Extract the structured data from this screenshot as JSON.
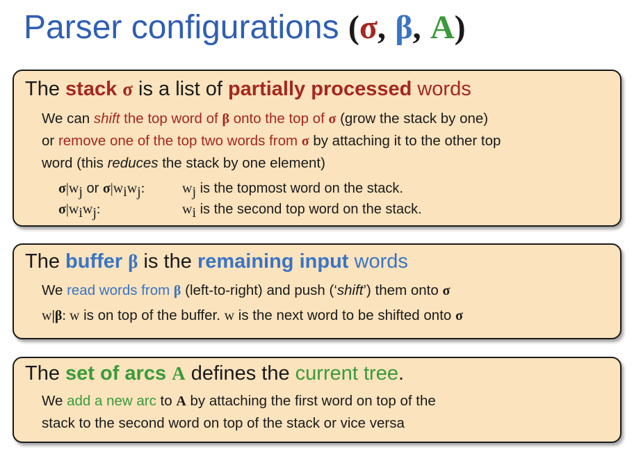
{
  "title": {
    "text": "Parser configurations",
    "open_paren": "(",
    "sigma": "σ",
    "comma1": ",",
    "beta": "β",
    "comma2": ",",
    "arcs": "A",
    "close_paren": ")"
  },
  "stack_box": {
    "heading": {
      "p1": "The ",
      "stack": "stack",
      "sigma": "σ",
      "p2": " is a list of ",
      "partially_processed": "partially processed",
      "words": " words"
    },
    "body": {
      "we_can": "We can ",
      "shift": "shift",
      "the_top_word_of": " the top word of ",
      "beta": "β",
      "onto_top_of": " onto the top of ",
      "sigma": "σ",
      "grow": " (grow the stack by one)",
      "or": "or ",
      "remove": "remove one of the top two words from ",
      "sigma2": "σ",
      "attaching": " by attaching it to the other top",
      "word_this": "word (this ",
      "reduces": "reduces",
      "by_one": " the stack by one element)"
    },
    "notation": [
      {
        "sigma": "σ",
        "bar_wj": "|w",
        "j": "j",
        "or": " or ",
        "sigma2": "σ",
        "bar_wi": "|w",
        "i": "i",
        "w": "w",
        "j2": "j",
        "colon": ":",
        "desc_w": "w",
        "desc_j": "j",
        "desc": " is the topmost word on the stack."
      },
      {
        "sigma": "σ",
        "bar_wi": "|w",
        "i": "i",
        "w": "w",
        "j": "j",
        "colon": ":",
        "desc_w": "w",
        "desc_i": "i",
        "desc": " is the second top word on the stack."
      }
    ]
  },
  "buffer_box": {
    "heading": {
      "p1": "The ",
      "buffer": "buffer",
      "beta": "β",
      "p2": " is the ",
      "remaining_input": "remaining input",
      "words": " words"
    },
    "line1": {
      "we": "We ",
      "read_words": "read words from ",
      "beta": "β",
      "rest": " (left-to-right) and push (‘",
      "shift": "shift",
      "rest2": "’) them onto ",
      "sigma": "σ"
    },
    "line2": {
      "w": "w",
      "bar_beta": "|β",
      "colon": ": ",
      "w2": "w",
      "mid": " is on top of the buffer. ",
      "w3": "w",
      "end": " is the next word to be shifted onto ",
      "sigma": "σ"
    }
  },
  "arcs_box": {
    "heading": {
      "p1": "The ",
      "set_of_arcs": "set of arcs",
      "a": "A",
      "defines": " defines the ",
      "current_tree": "current tree",
      "period": "."
    },
    "body": {
      "we": "We ",
      "add_arc": "add a new arc",
      "to": " to ",
      "a": "A",
      "rest1": " by attaching the first word on top of the",
      "rest2": "stack to the second word on top of the stack or vice versa"
    }
  },
  "colors": {
    "title_blue": "#2f5fb3",
    "red": "#a5281f",
    "blue": "#3a74c4",
    "green": "#3a9a3a",
    "box_fill": "#fae3bd"
  }
}
